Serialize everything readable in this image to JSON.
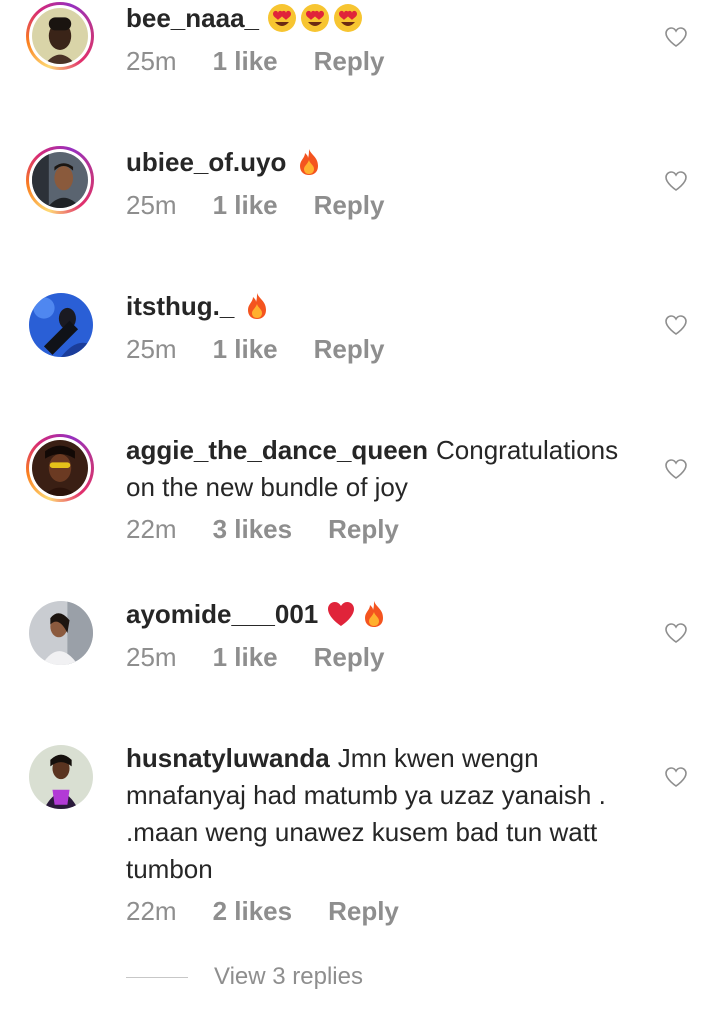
{
  "comments": [
    {
      "username": "bee_naaa_",
      "text": "",
      "emojis": [
        "heart-eyes",
        "heart-eyes",
        "heart-eyes"
      ],
      "time": "25m",
      "likes": "1 like",
      "reply": "Reply"
    },
    {
      "username": "ubiee_of.uyo",
      "text": "",
      "emojis": [
        "fire"
      ],
      "time": "25m",
      "likes": "1 like",
      "reply": "Reply"
    },
    {
      "username": "itsthug._",
      "text": "",
      "emojis": [
        "fire"
      ],
      "time": "25m",
      "likes": "1 like",
      "reply": "Reply"
    },
    {
      "username": "aggie_the_dance_queen",
      "text": "Congratulations on the new bundle of joy",
      "emojis": [],
      "time": "22m",
      "likes": "3 likes",
      "reply": "Reply"
    },
    {
      "username": "ayomide___001",
      "text": "",
      "emojis": [
        "red-heart",
        "fire"
      ],
      "time": "25m",
      "likes": "1 like",
      "reply": "Reply"
    },
    {
      "username": "husnatyluwanda",
      "text": "Jmn kwen wengn mnafanyaj had matumb ya uzaz yanaish . .maan weng unawez kusem bad tun watt tumbon",
      "emojis": [],
      "time": "22m",
      "likes": "2 likes",
      "reply": "Reply"
    }
  ],
  "view_replies": "View 3 replies",
  "colors": {
    "text": "#262626",
    "meta": "#8e8e8e",
    "story_ring": "#d62976"
  }
}
